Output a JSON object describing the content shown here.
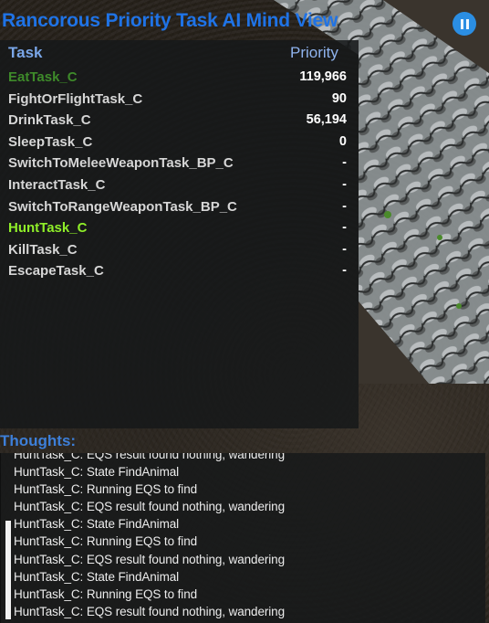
{
  "title": "Rancorous Priority Task AI Mind View",
  "columns": {
    "task": "Task",
    "priority": "Priority"
  },
  "tasks": [
    {
      "name": "EatTask_C",
      "priority": "119,966",
      "state": "dim"
    },
    {
      "name": "FightOrFlightTask_C",
      "priority": "90",
      "state": "normal"
    },
    {
      "name": "DrinkTask_C",
      "priority": "56,194",
      "state": "normal"
    },
    {
      "name": "SleepTask_C",
      "priority": "0",
      "state": "normal"
    },
    {
      "name": "SwitchToMeleeWeaponTask_BP_C",
      "priority": "-",
      "state": "normal"
    },
    {
      "name": "InteractTask_C",
      "priority": "-",
      "state": "normal"
    },
    {
      "name": "SwitchToRangeWeaponTask_BP_C",
      "priority": "-",
      "state": "normal"
    },
    {
      "name": "HuntTask_C",
      "priority": "-",
      "state": "active"
    },
    {
      "name": "KillTask_C",
      "priority": "-",
      "state": "normal"
    },
    {
      "name": "EscapeTask_C",
      "priority": "-",
      "state": "normal"
    }
  ],
  "thoughts": {
    "label": "Thoughts:",
    "lines": [
      "HuntTask_C: EQS result found nothing, wandering",
      "HuntTask_C: State FindAnimal",
      "HuntTask_C: Running EQS to find",
      "HuntTask_C: EQS result found nothing, wandering",
      "HuntTask_C: State FindAnimal",
      "HuntTask_C: Running EQS to find",
      "HuntTask_C: EQS result found nothing, wandering",
      "HuntTask_C: State FindAnimal",
      "HuntTask_C: Running EQS to find",
      "HuntTask_C: EQS result found nothing, wandering"
    ]
  },
  "icons": {
    "pause": "pause-icon"
  },
  "colors": {
    "title": "#1f73e6",
    "active_task": "#8fef29",
    "dim_task": "#3e8a2a",
    "pause_button": "#2b8ee3"
  }
}
